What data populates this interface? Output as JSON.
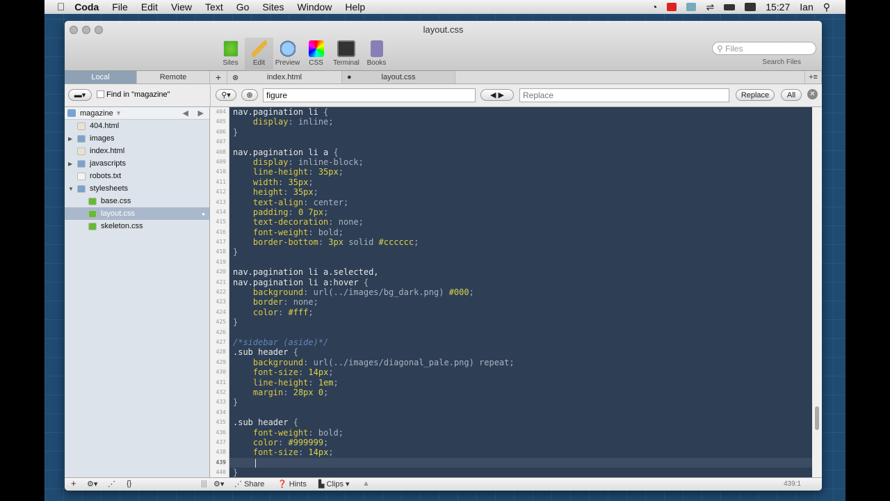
{
  "menubar": {
    "app": "Coda",
    "items": [
      "File",
      "Edit",
      "View",
      "Text",
      "Go",
      "Sites",
      "Window",
      "Help"
    ],
    "clock": "15:27",
    "user": "Ian"
  },
  "window": {
    "title": "layout.css"
  },
  "toolbar": {
    "tools": [
      "Sites",
      "Edit",
      "Preview",
      "CSS",
      "Terminal",
      "Books"
    ],
    "active": "Edit",
    "search_placeholder": "Files",
    "search_label": "Search Files"
  },
  "tabs": {
    "local": "Local",
    "remote": "Remote",
    "add": "+",
    "files": [
      "index.html",
      "layout.css"
    ],
    "menu": "+≡"
  },
  "find": {
    "find_in": "Find in \"magazine\"",
    "query": "figure",
    "replace_placeholder": "Replace",
    "replace_btn": "Replace",
    "all_btn": "All"
  },
  "sidebar": {
    "root": "magazine",
    "items": [
      {
        "name": "404.html",
        "type": "html",
        "depth": 1
      },
      {
        "name": "images",
        "type": "folder",
        "depth": 1,
        "expanded": false
      },
      {
        "name": "index.html",
        "type": "html",
        "depth": 1
      },
      {
        "name": "javascripts",
        "type": "folder",
        "depth": 1,
        "expanded": false
      },
      {
        "name": "robots.txt",
        "type": "txt",
        "depth": 1
      },
      {
        "name": "stylesheets",
        "type": "folder",
        "depth": 1,
        "expanded": true
      },
      {
        "name": "base.css",
        "type": "css",
        "depth": 2
      },
      {
        "name": "layout.css",
        "type": "css",
        "depth": 2,
        "selected": true
      },
      {
        "name": "skeleton.css",
        "type": "css",
        "depth": 2
      }
    ]
  },
  "editor": {
    "first_line": 404,
    "current_line": 439,
    "lines": [
      [
        [
          "sel-t",
          "nav.pagination li "
        ],
        [
          "pun",
          "{"
        ]
      ],
      [
        [
          "",
          "    "
        ],
        [
          "prop",
          "display"
        ],
        [
          "pun",
          ": "
        ],
        [
          "val",
          "inline;"
        ]
      ],
      [
        [
          "pun",
          "}"
        ]
      ],
      [],
      [
        [
          "sel-t",
          "nav.pagination li a "
        ],
        [
          "pun",
          "{"
        ]
      ],
      [
        [
          "",
          "    "
        ],
        [
          "prop",
          "display"
        ],
        [
          "pun",
          ": "
        ],
        [
          "val",
          "inline-block;"
        ]
      ],
      [
        [
          "",
          "    "
        ],
        [
          "prop",
          "line-height"
        ],
        [
          "pun",
          ": "
        ],
        [
          "num",
          "35px"
        ],
        [
          "pun",
          ";"
        ]
      ],
      [
        [
          "",
          "    "
        ],
        [
          "prop",
          "width"
        ],
        [
          "pun",
          ": "
        ],
        [
          "num",
          "35px"
        ],
        [
          "pun",
          ";"
        ]
      ],
      [
        [
          "",
          "    "
        ],
        [
          "prop",
          "height"
        ],
        [
          "pun",
          ": "
        ],
        [
          "num",
          "35px"
        ],
        [
          "pun",
          ";"
        ]
      ],
      [
        [
          "",
          "    "
        ],
        [
          "prop",
          "text-align"
        ],
        [
          "pun",
          ": "
        ],
        [
          "val",
          "center;"
        ]
      ],
      [
        [
          "",
          "    "
        ],
        [
          "prop",
          "padding"
        ],
        [
          "pun",
          ": "
        ],
        [
          "num",
          "0 7px"
        ],
        [
          "pun",
          ";"
        ]
      ],
      [
        [
          "",
          "    "
        ],
        [
          "prop",
          "text-decoration"
        ],
        [
          "pun",
          ": "
        ],
        [
          "val",
          "none;"
        ]
      ],
      [
        [
          "",
          "    "
        ],
        [
          "prop",
          "font-weight"
        ],
        [
          "pun",
          ": "
        ],
        [
          "val",
          "bold;"
        ]
      ],
      [
        [
          "",
          "    "
        ],
        [
          "prop",
          "border-bottom"
        ],
        [
          "pun",
          ": "
        ],
        [
          "num",
          "3px"
        ],
        [
          "val",
          " solid "
        ],
        [
          "num",
          "#cccccc"
        ],
        [
          "pun",
          ";"
        ]
      ],
      [
        [
          "pun",
          "}"
        ]
      ],
      [],
      [
        [
          "sel-t",
          "nav.pagination li a.selected,"
        ]
      ],
      [
        [
          "sel-t",
          "nav.pagination li a:hover "
        ],
        [
          "pun",
          "{"
        ]
      ],
      [
        [
          "",
          "    "
        ],
        [
          "prop",
          "background"
        ],
        [
          "pun",
          ": "
        ],
        [
          "val",
          "url(../images/bg_dark.png) "
        ],
        [
          "num",
          "#000"
        ],
        [
          "pun",
          ";"
        ]
      ],
      [
        [
          "",
          "    "
        ],
        [
          "prop",
          "border"
        ],
        [
          "pun",
          ": "
        ],
        [
          "val",
          "none;"
        ]
      ],
      [
        [
          "",
          "    "
        ],
        [
          "prop",
          "color"
        ],
        [
          "pun",
          ": "
        ],
        [
          "num",
          "#fff"
        ],
        [
          "pun",
          ";"
        ]
      ],
      [
        [
          "pun",
          "}"
        ]
      ],
      [],
      [
        [
          "com",
          "/*sidebar (aside)*/"
        ]
      ],
      [
        [
          "sel-t",
          ".sub header "
        ],
        [
          "pun",
          "{"
        ]
      ],
      [
        [
          "",
          "    "
        ],
        [
          "prop",
          "background"
        ],
        [
          "pun",
          ": "
        ],
        [
          "val",
          "url(../images/diagonal_pale.png) repeat;"
        ]
      ],
      [
        [
          "",
          "    "
        ],
        [
          "prop",
          "font-size"
        ],
        [
          "pun",
          ": "
        ],
        [
          "num",
          "14px"
        ],
        [
          "pun",
          ";"
        ]
      ],
      [
        [
          "",
          "    "
        ],
        [
          "prop",
          "line-height"
        ],
        [
          "pun",
          ": "
        ],
        [
          "num",
          "1em"
        ],
        [
          "pun",
          ";"
        ]
      ],
      [
        [
          "",
          "    "
        ],
        [
          "prop",
          "margin"
        ],
        [
          "pun",
          ": "
        ],
        [
          "num",
          "28px 0"
        ],
        [
          "pun",
          ";"
        ]
      ],
      [
        [
          "pun",
          "}"
        ]
      ],
      [],
      [
        [
          "sel-t",
          ".sub header "
        ],
        [
          "pun",
          "{"
        ]
      ],
      [
        [
          "",
          "    "
        ],
        [
          "prop",
          "font-weight"
        ],
        [
          "pun",
          ": "
        ],
        [
          "val",
          "bold;"
        ]
      ],
      [
        [
          "",
          "    "
        ],
        [
          "prop",
          "color"
        ],
        [
          "pun",
          ": "
        ],
        [
          "num",
          "#999999"
        ],
        [
          "pun",
          ";"
        ]
      ],
      [
        [
          "",
          "    "
        ],
        [
          "prop",
          "font-size"
        ],
        [
          "pun",
          ": "
        ],
        [
          "num",
          "14px"
        ],
        [
          "pun",
          ";"
        ]
      ],
      [
        [
          "",
          "    |"
        ]
      ],
      [
        [
          "pun",
          "}"
        ]
      ]
    ]
  },
  "bottombar": {
    "share": "Share",
    "hints": "Hints",
    "clips": "Clips",
    "position": "439:1"
  },
  "colors": {
    "editor_bg": "#2e3e54",
    "property": "#d9c94a",
    "selector": "#e8e8e8",
    "comment": "#5f86bd"
  }
}
